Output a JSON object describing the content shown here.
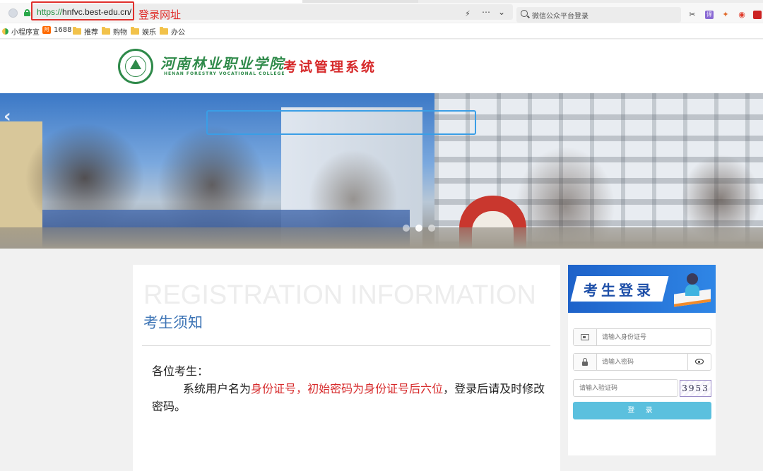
{
  "browser": {
    "url_scheme": "https://",
    "url_rest": "hnfvc.best-edu.cn/",
    "url_annotation": "登录网址",
    "search_placeholder": "微信公众平台登录",
    "bookmarks": [
      {
        "label": "小程序宣",
        "icon": "mini-program-icon"
      },
      {
        "label": "1688",
        "icon": "alibaba-1688-icon"
      },
      {
        "label": "推荐",
        "icon": "folder-icon"
      },
      {
        "label": "购物",
        "icon": "folder-icon"
      },
      {
        "label": "娱乐",
        "icon": "folder-icon"
      },
      {
        "label": "办公",
        "icon": "folder-icon"
      }
    ],
    "lock_color": "#2aa84a",
    "annotation_color": "#e0302c"
  },
  "header": {
    "college_cn": "河南林业职业学院",
    "college_en": "HENAN FORESTRY VOCATIONAL COLLEGE",
    "system_title": "考试管理系统",
    "brand_green": "#2f8a4a",
    "title_red": "#d6292a"
  },
  "banner": {
    "prev_glyph": "‹",
    "slide_count": 3,
    "active_slide": 2
  },
  "notice": {
    "watermark": "REGISTRATION INFORMATION",
    "title": "考生须知",
    "greeting": "各位考生：",
    "para_prefix": "系统",
    "para_hl_1": "用户名为",
    "para_red_1": "身份证号",
    "para_comma": "，",
    "para_red_2": "初始密码为身份证号后六位",
    "para_suffix": "，登录后请及时修改密码。",
    "title_color": "#3d74b5",
    "highlight_color": "#3a9ee6"
  },
  "login": {
    "title": "考生登录",
    "id_placeholder": "请输入身份证号",
    "password_placeholder": "请输入密码",
    "captcha_placeholder": "请输入验证码",
    "captcha_code": "3953",
    "submit_label": "登 录",
    "button_color": "#5bc0de"
  }
}
